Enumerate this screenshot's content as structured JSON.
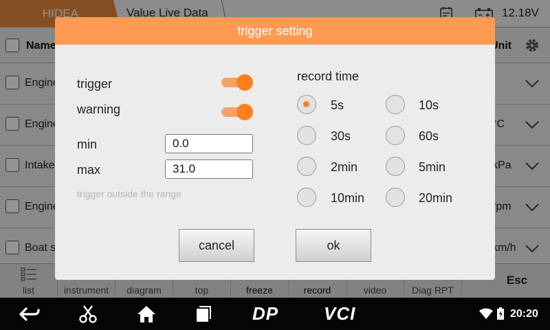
{
  "app": {
    "brand_tab": "HIDEA",
    "title_tab": "Value Live Data",
    "voltage": "12.18V"
  },
  "table": {
    "header_name": "Name",
    "header_unit": "Unit",
    "rows": [
      {
        "name": "Engine",
        "unit": ""
      },
      {
        "name": "Engine",
        "unit": "°C"
      },
      {
        "name": "Intake",
        "unit": "kPa"
      },
      {
        "name": "Engine",
        "unit": "rpm"
      },
      {
        "name": "Boat s",
        "unit": "km/h"
      }
    ]
  },
  "toolbar": {
    "items": [
      "list",
      "instrument",
      "diagram",
      "top",
      "freeze",
      "record",
      "video",
      "Diag RPT"
    ],
    "esc": "Esc"
  },
  "navbar": {
    "dp_label": "DP",
    "vci_label": "VCI",
    "time": "20:20"
  },
  "dialog": {
    "title": "trigger setting",
    "trigger_label": "trigger",
    "trigger_on": true,
    "warning_label": "warning",
    "warning_on": true,
    "min_label": "min",
    "min_value": "0.0",
    "max_label": "max",
    "max_value": "31.0",
    "hint": "trigger outside the range",
    "record_time_label": "record time",
    "record_options": [
      "5s",
      "10s",
      "30s",
      "60s",
      "2min",
      "5min",
      "10min",
      "20min"
    ],
    "selected_record": "5s",
    "cancel_label": "cancel",
    "ok_label": "ok"
  },
  "colors": {
    "accent": "#ff9a52",
    "switch_knob": "#ff7f1e",
    "brand_tab": "#e6883d"
  }
}
